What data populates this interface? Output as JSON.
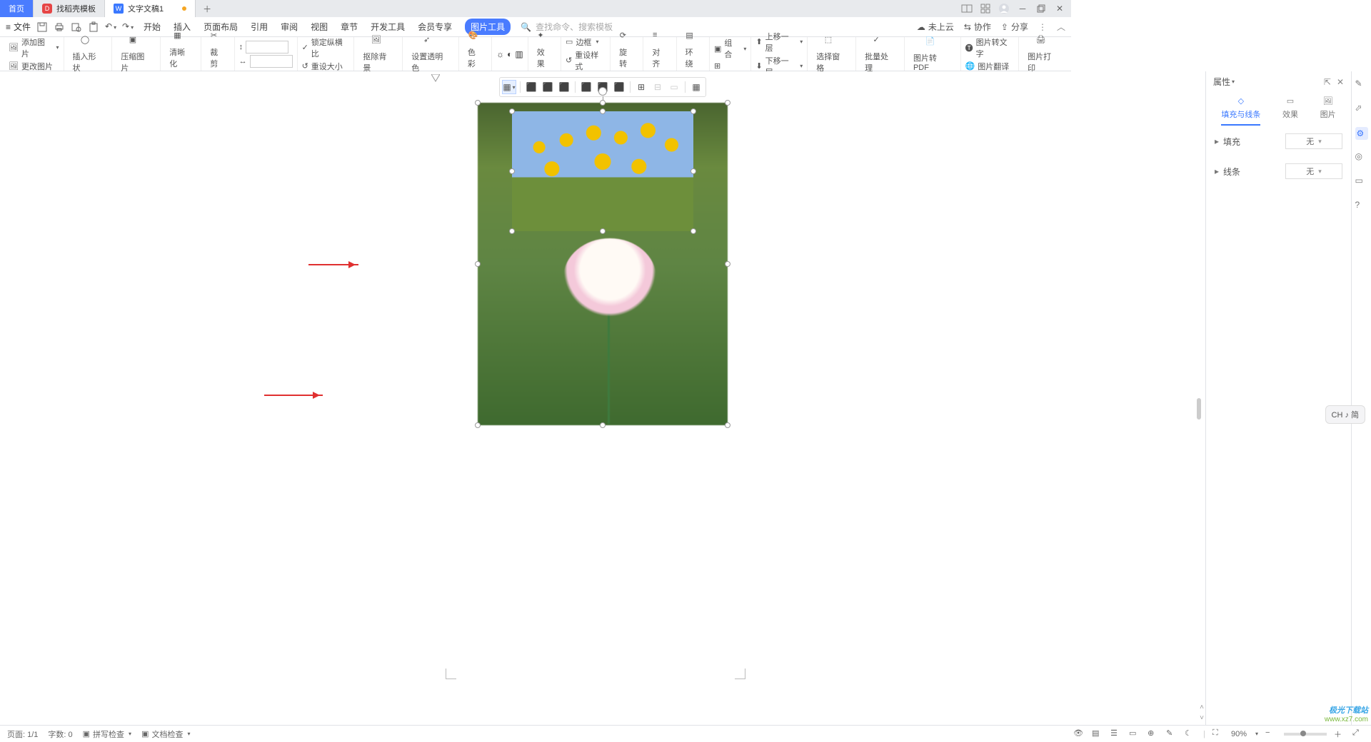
{
  "tabs": {
    "home": "首页",
    "template": "找稻壳模板",
    "doc": "文字文稿1"
  },
  "menubar": {
    "file": "文件",
    "items": [
      "开始",
      "插入",
      "页面布局",
      "引用",
      "审阅",
      "视图",
      "章节",
      "开发工具",
      "会员专享",
      "图片工具"
    ],
    "active_index": 9,
    "search_placeholder": "查找命令、搜索模板",
    "cloud": "未上云",
    "coop": "协作",
    "share": "分享"
  },
  "ribbon": {
    "add_image": "添加图片",
    "change_image": "更改图片",
    "insert_shape": "插入形状",
    "compress": "压缩图片",
    "sharpen": "清晰化",
    "crop": "裁剪",
    "lock_ratio": "锁定纵横比",
    "reset_size": "重设大小",
    "remove_bg": "抠除背景",
    "set_transparent": "设置透明色",
    "color": "色彩",
    "effect": "效果",
    "reset_style": "重设样式",
    "border": "边框",
    "rotate": "旋转",
    "align": "对齐",
    "wrap": "环绕",
    "group": "组合",
    "up_layer": "上移一层",
    "down_layer": "下移一层",
    "select_pane": "选择窗格",
    "batch": "批量处理",
    "to_pdf": "图片转PDF",
    "to_text": "图片转文字",
    "translate": "图片翻译",
    "print": "图片打印"
  },
  "side": {
    "title": "属性",
    "tabs": {
      "fill": "填充与线条",
      "effect": "效果",
      "picture": "图片"
    },
    "fill_label": "填充",
    "line_label": "线条",
    "none": "无"
  },
  "ime": "CH ♪ 简",
  "status": {
    "page": "页面: 1/1",
    "words": "字数: 0",
    "spell": "拼写检查",
    "doc_check": "文档检查",
    "zoom": "90%"
  },
  "watermark": {
    "brand": "极光下载站",
    "url": "www.xz7.com"
  }
}
